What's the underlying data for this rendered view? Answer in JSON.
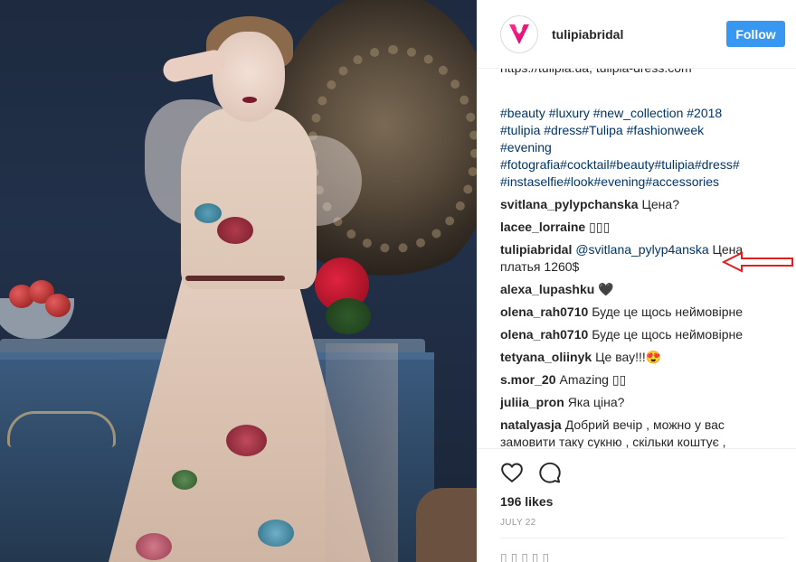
{
  "profile": {
    "username": "tulipiabridal",
    "follow_label": "Follow"
  },
  "caption": {
    "cut_line": "https://tulipia.ua, tulipia-dress.com",
    "hashtag_lines": [
      "#beauty #luxury #new_collection #2018",
      "#tulipia #dress#Tulipa #fashionweek",
      "#evening",
      "#fotografia#cocktail#beauty#tulipia#dress#",
      "#instaselfie#look#evening#accessories"
    ]
  },
  "comments": [
    {
      "user": "svitlana_pylypchanska",
      "text": "Цена?"
    },
    {
      "user": "lacee_lorraine",
      "text": "▯▯▯"
    },
    {
      "user": "tulipiabridal",
      "mention": "@svitlana_pylyp4anska",
      "text": " Цена",
      "text2": "платья 1260$"
    },
    {
      "user": "alexa_lupashku",
      "text": "🖤"
    },
    {
      "user": "olena_rah0710",
      "text": "Буде це щось неймовірне"
    },
    {
      "user": "olena_rah0710",
      "text": "Буде це щось неймовірне"
    },
    {
      "user": "tetyana_oliinyk",
      "text": "Це вау!!!😍"
    },
    {
      "user": "s.mor_20",
      "text": "Amazing ▯▯"
    },
    {
      "user": "juliia_pron",
      "text": "Яка ціна?"
    },
    {
      "user": "natalyasja",
      "text": "Добрий вечір , можно у вас",
      "text2": "замовити таку сукню , скільки коштує ,"
    }
  ],
  "actions": {
    "like_icon": "heart-icon",
    "comment_icon": "comment-icon"
  },
  "likes": "196 likes",
  "date": "JULY 22",
  "add_comment_partial": "▯ ▯ ▯ ▯ ▯",
  "colors": {
    "follow_button": "#3897f0",
    "hashtag": "#003569",
    "annotation_arrow": "#e02020"
  }
}
